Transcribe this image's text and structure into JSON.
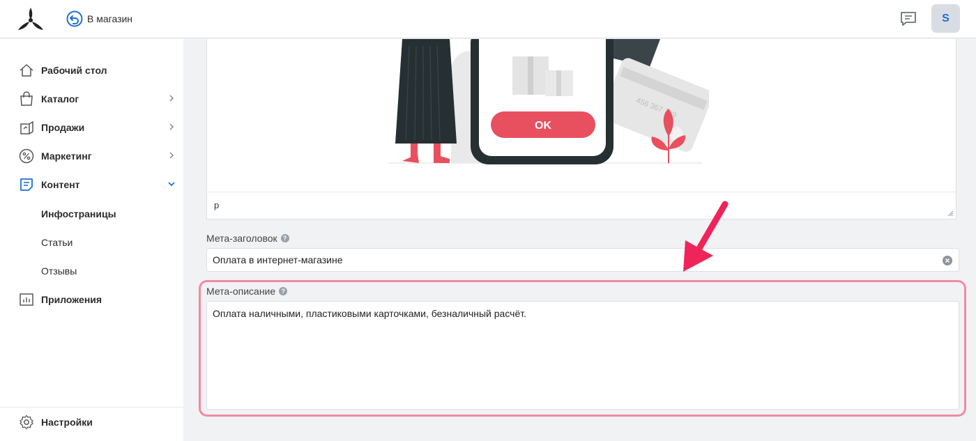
{
  "header": {
    "back_link_label": "В магазин",
    "avatar_letter": "S"
  },
  "sidebar": {
    "items": [
      {
        "label": "Рабочий стол",
        "icon": "home-icon"
      },
      {
        "label": "Каталог",
        "icon": "bag-icon"
      },
      {
        "label": "Продажи",
        "icon": "sales-icon"
      },
      {
        "label": "Маркетинг",
        "icon": "percent-icon"
      },
      {
        "label": "Контент",
        "icon": "content-icon"
      },
      {
        "label": "Приложения",
        "icon": "apps-icon"
      }
    ],
    "content_subitems": [
      "Инфостраницы",
      "Статьи",
      "Отзывы"
    ],
    "active_subitem": "Инфостраницы",
    "settings_label": "Настройки"
  },
  "editor": {
    "image_button_label": "OK",
    "card_number_fragment": "456 367 789",
    "status_path": "p"
  },
  "form": {
    "meta_title_label": "Мета-заголовок",
    "meta_title_value": "Оплата в интернет-магазине",
    "meta_description_label": "Мета-описание",
    "meta_description_value": "Оплата наличными, пластиковыми карточками, безналичный расчёт.",
    "help_glyph": "?"
  },
  "colors": {
    "accent": "#1f6fd1",
    "highlight": "#f08aa5",
    "arrow": "#f0245a",
    "button": "#e8505f"
  }
}
